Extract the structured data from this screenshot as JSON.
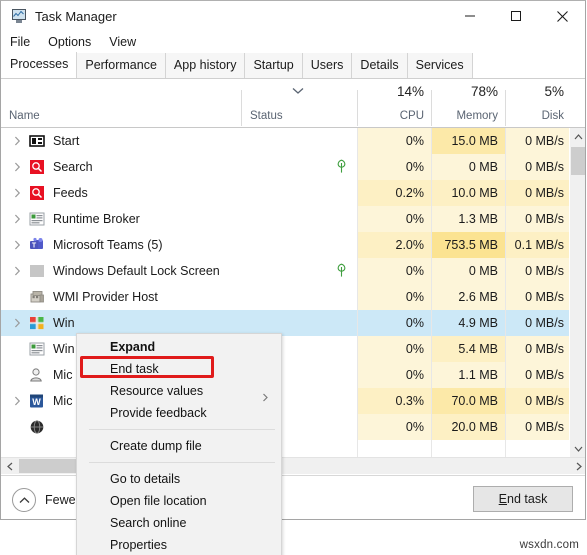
{
  "window": {
    "title": "Task Manager",
    "icon": "task-manager-icon",
    "controls": {
      "minimize": "minimize-icon",
      "maximize": "maximize-icon",
      "close": "close-icon"
    }
  },
  "menubar": {
    "items": [
      {
        "label": "File"
      },
      {
        "label": "Options"
      },
      {
        "label": "View"
      }
    ]
  },
  "tabs": [
    {
      "label": "Processes",
      "active": true
    },
    {
      "label": "Performance",
      "active": false
    },
    {
      "label": "App history",
      "active": false
    },
    {
      "label": "Startup",
      "active": false
    },
    {
      "label": "Users",
      "active": false
    },
    {
      "label": "Details",
      "active": false
    },
    {
      "label": "Services",
      "active": false
    }
  ],
  "columns": {
    "name": {
      "label": "Name",
      "sorted": false
    },
    "status": {
      "label": "Status",
      "sorted": true,
      "sort_icon": "chevron-down-icon"
    },
    "cpu": {
      "label": "CPU",
      "usage": "14%"
    },
    "memory": {
      "label": "Memory",
      "usage": "78%"
    },
    "disk": {
      "label": "Disk",
      "usage": "5%"
    }
  },
  "processes": [
    {
      "name": "Start",
      "icon": "start-tile-icon",
      "expandable": true,
      "status": "",
      "cpu": "0%",
      "memory": "15.0 MB",
      "disk": "0 MB/s",
      "cpu_heat": "h0",
      "mem_heat": "h2",
      "disk_heat": "h0",
      "selected": false,
      "occluded": false
    },
    {
      "name": "Search",
      "icon": "search-magnifier-icon",
      "expandable": true,
      "status": "leaf-icon",
      "cpu": "0%",
      "memory": "0 MB",
      "disk": "0 MB/s",
      "cpu_heat": "h0",
      "mem_heat": "h0",
      "disk_heat": "h0",
      "selected": false,
      "occluded": false
    },
    {
      "name": "Feeds",
      "icon": "search-magnifier-icon",
      "expandable": true,
      "status": "",
      "cpu": "0.2%",
      "memory": "10.0 MB",
      "disk": "0 MB/s",
      "cpu_heat": "h1",
      "mem_heat": "h1",
      "disk_heat": "h1",
      "selected": false,
      "occluded": false
    },
    {
      "name": "Runtime Broker",
      "icon": "runtime-broker-icon",
      "expandable": true,
      "status": "",
      "cpu": "0%",
      "memory": "1.3 MB",
      "disk": "0 MB/s",
      "cpu_heat": "h0",
      "mem_heat": "h0",
      "disk_heat": "h0",
      "selected": false,
      "occluded": false
    },
    {
      "name": "Microsoft Teams (5)",
      "icon": "teams-icon",
      "expandable": true,
      "status": "",
      "cpu": "2.0%",
      "memory": "753.5 MB",
      "disk": "0.1 MB/s",
      "cpu_heat": "h1",
      "mem_heat": "h3",
      "disk_heat": "h1",
      "selected": false,
      "occluded": false
    },
    {
      "name": "Windows Default Lock Screen",
      "icon": "blank-tile-icon",
      "expandable": true,
      "status": "leaf-icon",
      "cpu": "0%",
      "memory": "0 MB",
      "disk": "0 MB/s",
      "cpu_heat": "h0",
      "mem_heat": "h0",
      "disk_heat": "h0",
      "selected": false,
      "occluded": false
    },
    {
      "name": "WMI Provider Host",
      "icon": "wmi-host-icon",
      "expandable": false,
      "status": "",
      "cpu": "0%",
      "memory": "2.6 MB",
      "disk": "0 MB/s",
      "cpu_heat": "h0",
      "mem_heat": "h0",
      "disk_heat": "h0",
      "selected": false,
      "occluded": false
    },
    {
      "name": "Win",
      "icon": "windows-store-icon",
      "expandable": true,
      "status": "",
      "cpu": "0%",
      "memory": "4.9 MB",
      "disk": "0 MB/s",
      "cpu_heat": "hw",
      "mem_heat": "hw",
      "disk_heat": "hw",
      "selected": true,
      "occluded": true
    },
    {
      "name": "Win",
      "icon": "runtime-broker-icon",
      "expandable": false,
      "status": "",
      "cpu": "0%",
      "memory": "5.4 MB",
      "disk": "0 MB/s",
      "cpu_heat": "h0",
      "mem_heat": "h1",
      "disk_heat": "h0",
      "selected": false,
      "occluded": true
    },
    {
      "name": "Mic",
      "icon": "user-account-icon",
      "expandable": false,
      "status": "",
      "cpu": "0%",
      "memory": "1.1 MB",
      "disk": "0 MB/s",
      "cpu_heat": "h0",
      "mem_heat": "h0",
      "disk_heat": "h0",
      "selected": false,
      "occluded": true
    },
    {
      "name": "Mic",
      "icon": "word-icon",
      "expandable": true,
      "status": "",
      "cpu": "0.3%",
      "memory": "70.0 MB",
      "disk": "0 MB/s",
      "cpu_heat": "h1",
      "mem_heat": "h2",
      "disk_heat": "h1",
      "selected": false,
      "occluded": true
    },
    {
      "name": "",
      "icon": "dark-globe-icon",
      "expandable": false,
      "status": "",
      "cpu": "0%",
      "memory": "20.0 MB",
      "disk": "0 MB/s",
      "cpu_heat": "h0",
      "mem_heat": "h1",
      "disk_heat": "h0",
      "selected": false,
      "occluded": true
    }
  ],
  "context_menu": {
    "highlighted_item": "End task",
    "items": [
      {
        "label": "Expand",
        "bold": true,
        "submenu": false,
        "separator_after": false
      },
      {
        "label": "End task",
        "bold": false,
        "submenu": false,
        "separator_after": false
      },
      {
        "label": "Resource values",
        "bold": false,
        "submenu": true,
        "separator_after": false
      },
      {
        "label": "Provide feedback",
        "bold": false,
        "submenu": false,
        "separator_after": true
      },
      {
        "label": "Create dump file",
        "bold": false,
        "submenu": false,
        "separator_after": true
      },
      {
        "label": "Go to details",
        "bold": false,
        "submenu": false,
        "separator_after": false
      },
      {
        "label": "Open file location",
        "bold": false,
        "submenu": false,
        "separator_after": false
      },
      {
        "label": "Search online",
        "bold": false,
        "submenu": false,
        "separator_after": false
      },
      {
        "label": "Properties",
        "bold": false,
        "submenu": false,
        "separator_after": false
      }
    ]
  },
  "footer": {
    "fewer_details": "Fewer details",
    "fewer_icon": "chevron-up-circle-icon",
    "end_task_prefix": "",
    "end_task_accel": "E",
    "end_task_rest": "nd task"
  },
  "watermark": "wsxdn.com",
  "accents": {
    "selection": "#cce8f7",
    "highlight_box": "#e01b1b",
    "heat_low": "#fdf5d9",
    "heat_high": "#fbe392"
  }
}
